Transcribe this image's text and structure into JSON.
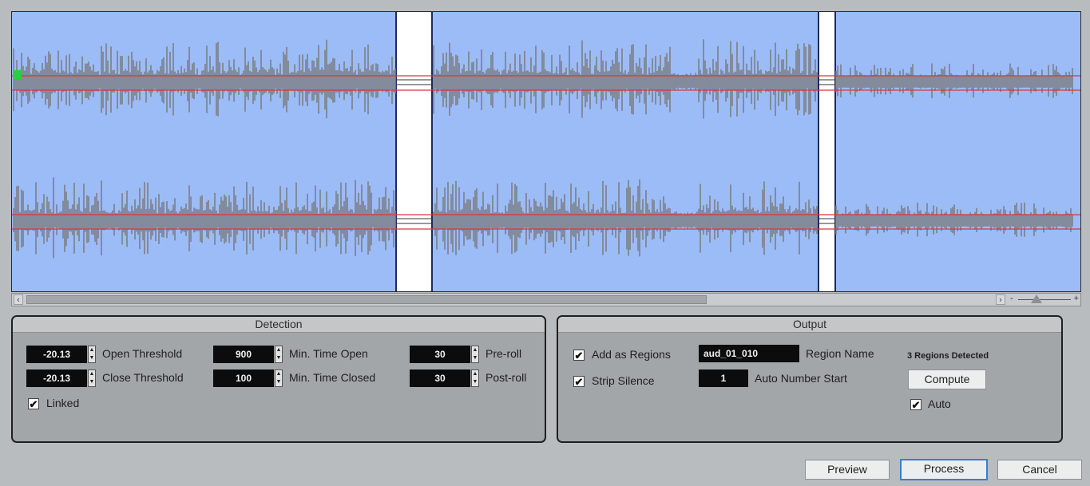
{
  "waveform": {
    "background_color": "#9bbcf7",
    "wave_color": "#7d7f85",
    "threshold_line_color": "#d93540",
    "silence_gap_color": "#ffffff",
    "start_marker_color": "#2ecc40"
  },
  "scrollbar": {
    "left_arrow": "‹",
    "right_arrow": "›",
    "zoom_minus": "-",
    "zoom_plus": "+"
  },
  "detection": {
    "title": "Detection",
    "open_threshold": {
      "value": "-20.13",
      "label": "Open Threshold"
    },
    "close_threshold": {
      "value": "-20.13",
      "label": "Close Threshold"
    },
    "min_time_open": {
      "value": "900",
      "label": "Min. Time Open"
    },
    "min_time_closed": {
      "value": "100",
      "label": "Min. Time Closed"
    },
    "pre_roll": {
      "value": "30",
      "label": "Pre-roll"
    },
    "post_roll": {
      "value": "30",
      "label": "Post-roll"
    },
    "linked": {
      "label": "Linked",
      "checked": true
    }
  },
  "output": {
    "title": "Output",
    "add_as_regions": {
      "label": "Add as Regions",
      "checked": true
    },
    "strip_silence": {
      "label": "Strip Silence",
      "checked": true
    },
    "region_name": {
      "value": "aud_01_010",
      "label": "Region Name"
    },
    "auto_number_start": {
      "value": "1",
      "label": "Auto Number Start"
    },
    "regions_detected": "3 Regions Detected",
    "compute_label": "Compute",
    "auto": {
      "label": "Auto",
      "checked": true
    }
  },
  "footer": {
    "preview_label": "Preview",
    "process_label": "Process",
    "cancel_label": "Cancel"
  }
}
